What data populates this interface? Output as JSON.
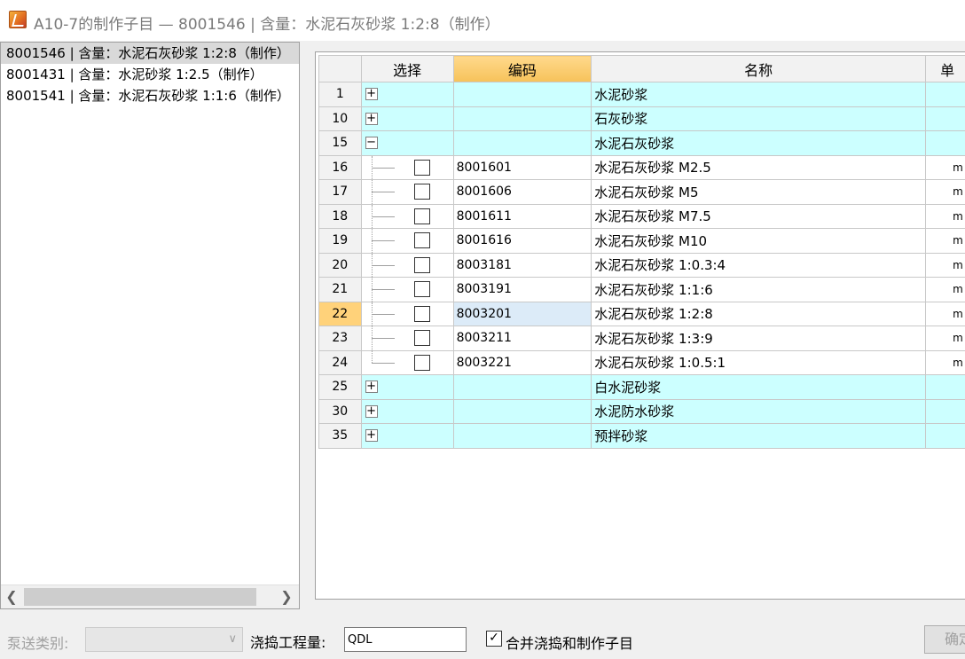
{
  "window": {
    "title": "A10-7的制作子目 — 8001546 | 含量：水泥石灰砂浆 1:2:8（制作）"
  },
  "left_list": {
    "items": [
      {
        "label": "8001546 | 含量：水泥石灰砂浆 1:2:8（制作）",
        "selected": true
      },
      {
        "label": "8001431 | 含量：水泥砂浆 1:2.5（制作）",
        "selected": false
      },
      {
        "label": "8001541 | 含量：水泥石灰砂浆 1:1:6（制作）",
        "selected": false
      }
    ]
  },
  "grid": {
    "headers": {
      "select": "选择",
      "code": "编码",
      "name": "名称",
      "unit": "单"
    },
    "rows": [
      {
        "num": "1",
        "type": "group",
        "expander": "+",
        "code": "",
        "name": "水泥砂浆",
        "unit": ""
      },
      {
        "num": "10",
        "type": "group",
        "expander": "+",
        "code": "",
        "name": "石灰砂浆",
        "unit": ""
      },
      {
        "num": "15",
        "type": "group",
        "expander": "−",
        "code": "",
        "name": "水泥石灰砂浆",
        "unit": ""
      },
      {
        "num": "16",
        "type": "item",
        "code": "8001601",
        "name": "水泥石灰砂浆 M2.5",
        "unit": "m"
      },
      {
        "num": "17",
        "type": "item",
        "code": "8001606",
        "name": "水泥石灰砂浆 M5",
        "unit": "m"
      },
      {
        "num": "18",
        "type": "item",
        "code": "8001611",
        "name": "水泥石灰砂浆 M7.5",
        "unit": "m"
      },
      {
        "num": "19",
        "type": "item",
        "code": "8001616",
        "name": "水泥石灰砂浆 M10",
        "unit": "m"
      },
      {
        "num": "20",
        "type": "item",
        "code": "8003181",
        "name": "水泥石灰砂浆 1:0.3:4",
        "unit": "m"
      },
      {
        "num": "21",
        "type": "item",
        "code": "8003191",
        "name": "水泥石灰砂浆 1:1:6",
        "unit": "m"
      },
      {
        "num": "22",
        "type": "item",
        "code": "8003201",
        "name": "水泥石灰砂浆 1:2:8",
        "unit": "m",
        "current": true
      },
      {
        "num": "23",
        "type": "item",
        "code": "8003211",
        "name": "水泥石灰砂浆 1:3:9",
        "unit": "m"
      },
      {
        "num": "24",
        "type": "item",
        "code": "8003221",
        "name": "水泥石灰砂浆 1:0.5:1",
        "unit": "m",
        "last": true
      },
      {
        "num": "25",
        "type": "group",
        "expander": "+",
        "code": "",
        "name": "白水泥砂浆",
        "unit": ""
      },
      {
        "num": "30",
        "type": "group",
        "expander": "+",
        "code": "",
        "name": "水泥防水砂浆",
        "unit": ""
      },
      {
        "num": "35",
        "type": "group",
        "expander": "+",
        "code": "",
        "name": "预拌砂浆",
        "unit": ""
      }
    ]
  },
  "bottom": {
    "pump_label": "泵送类别:",
    "pump_value": "",
    "pour_label": "浇捣工程量:",
    "pour_value": "QDL",
    "merge_checked": true,
    "merge_label": "合并浇捣和制作子目",
    "ok_label": "确定"
  },
  "colors": {
    "group_row_bg": "#ccffff",
    "sorted_header_bg": "#f6c25a",
    "current_row_num_bg": "#ffd27a",
    "focused_cell_bg": "#dcebf8"
  }
}
